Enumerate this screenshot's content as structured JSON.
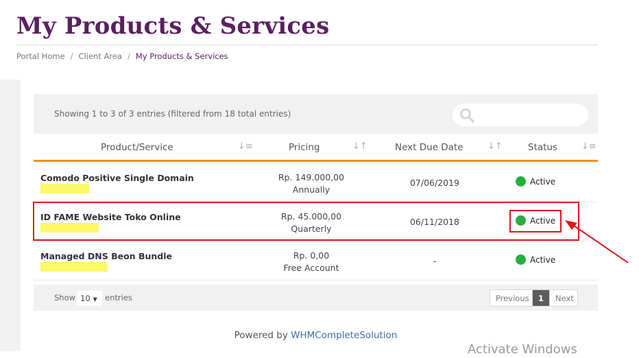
{
  "page": {
    "title": "My Products & Services"
  },
  "breadcrumb": {
    "items": [
      "Portal Home",
      "Client Area",
      "My Products & Services"
    ],
    "separator": "/"
  },
  "table": {
    "info": "Showing 1 to 3 of 3 entries (filtered from 18 total entries)",
    "search_placeholder": "",
    "columns": [
      "Product/Service",
      "Pricing",
      "Next Due Date",
      "Status"
    ],
    "rows": [
      {
        "product": "Comodo Positive Single Domain",
        "price": "Rp. 149.000,00",
        "cycle": "Annually",
        "due": "07/06/2019",
        "status": "Active"
      },
      {
        "product": "ID FAME Website Toko Online",
        "price": "Rp. 45.000,00",
        "cycle": "Quarterly",
        "due": "06/11/2018",
        "status": "Active"
      },
      {
        "product": "Managed DNS Beon Bundle",
        "price": "Rp. 0,00",
        "cycle": "Free Account",
        "due": "-",
        "status": "Active"
      }
    ],
    "length": {
      "show_label": "Show",
      "value": "10",
      "entries_label": "entries"
    },
    "pagination": {
      "previous": "Previous",
      "current": "1",
      "next": "Next"
    }
  },
  "footer": {
    "prefix": "Powered by",
    "link": "WHMCompleteSolution"
  },
  "watermark": "Activate Windows",
  "colors": {
    "title": "#5b1f60",
    "accent": "#f0921d",
    "status_active": "#27ae3f",
    "annotation": "#e0161b",
    "redaction": "#fbf86a"
  },
  "icons": {
    "search": "search-icon",
    "sort": "sort-icon",
    "status": "status-dot-icon",
    "annotation_arrow": "arrow-icon"
  }
}
